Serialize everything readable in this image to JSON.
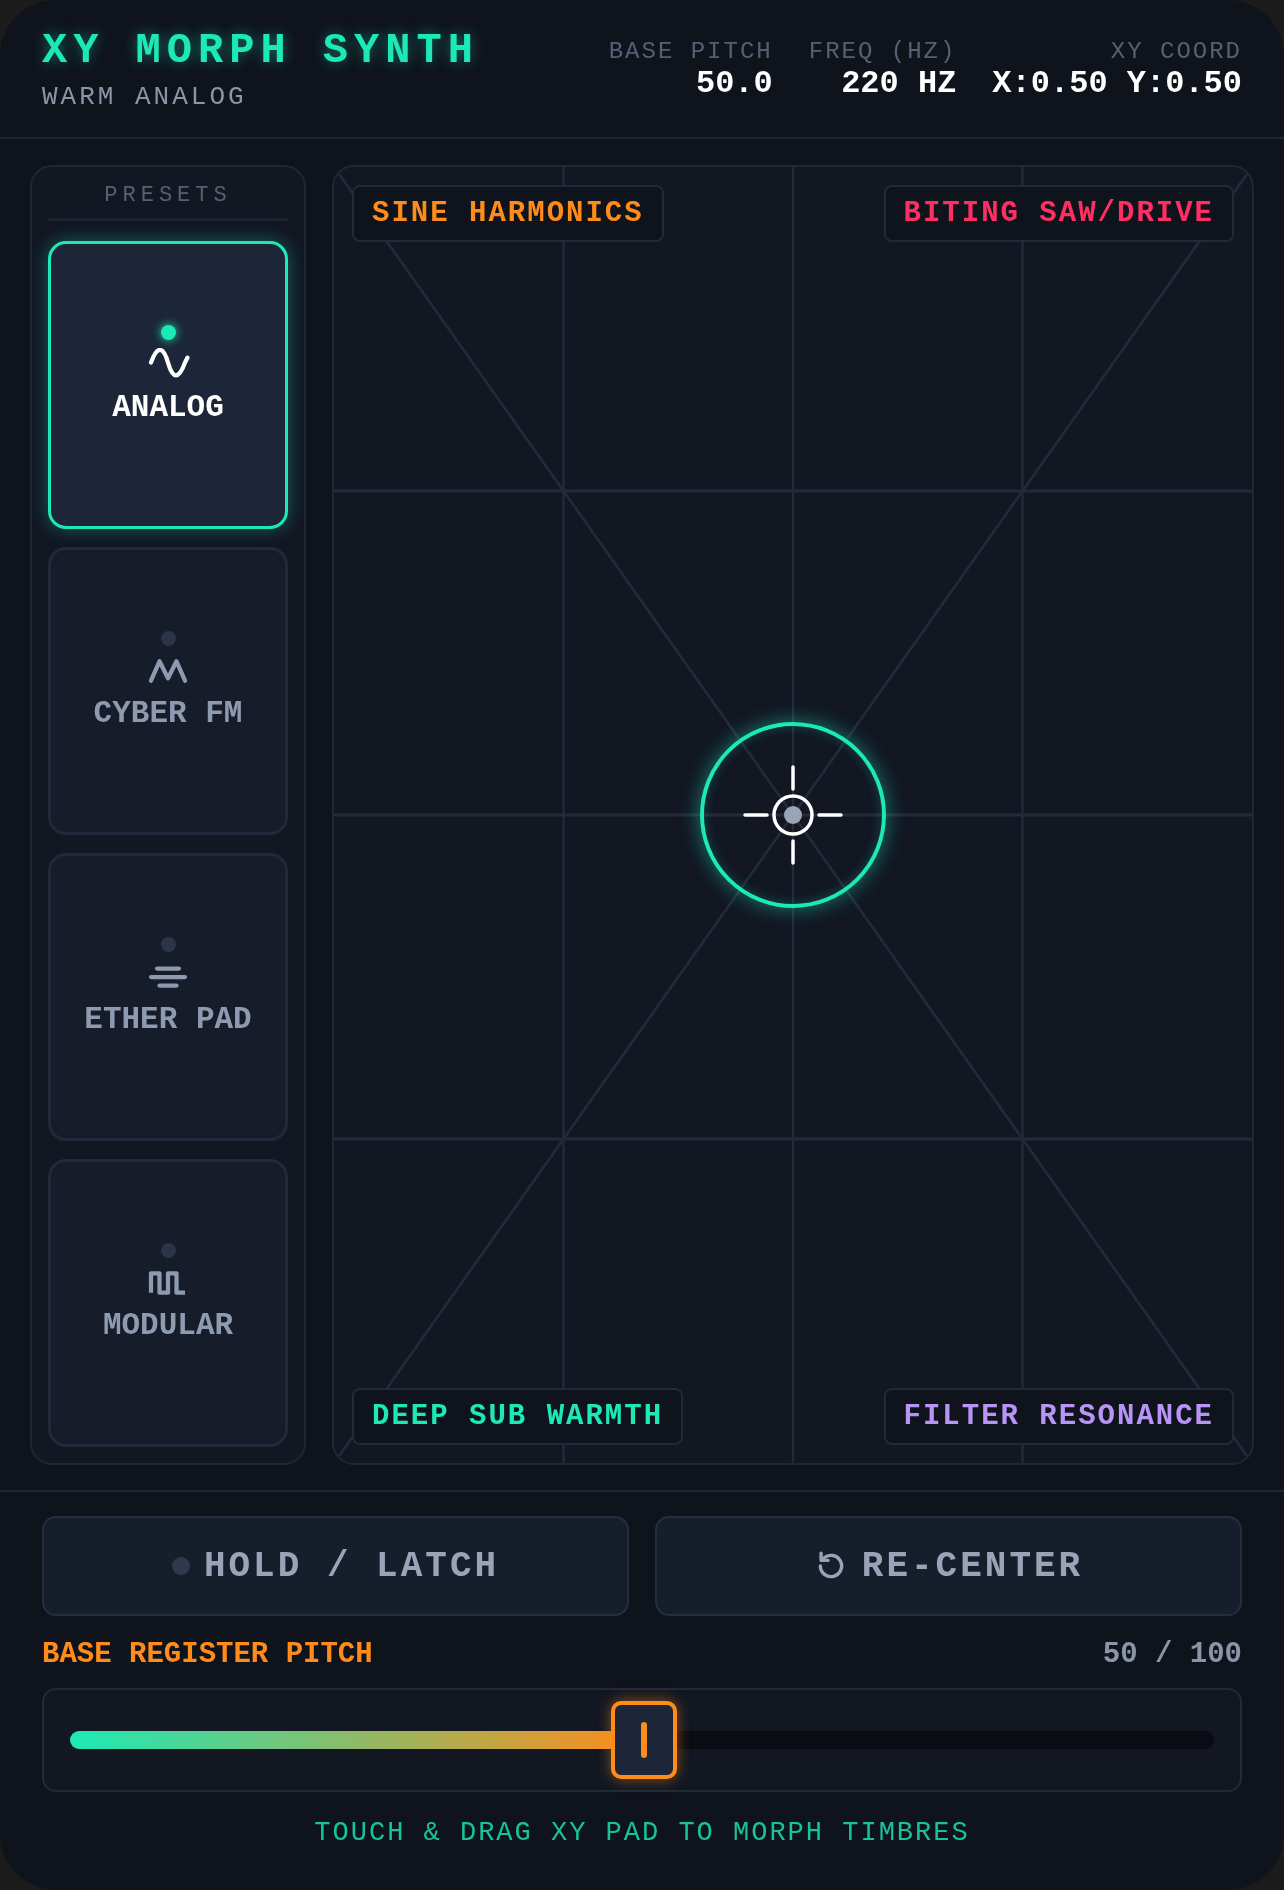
{
  "header": {
    "title": "XY MORPH SYNTH",
    "subtitle": "WARM ANALOG",
    "readouts": [
      {
        "label": "BASE PITCH",
        "value": "50.0"
      },
      {
        "label": "FREQ (HZ)",
        "value": "220 HZ"
      },
      {
        "label": "XY COORD",
        "value": "X:0.50 Y:0.50"
      }
    ]
  },
  "sidebar": {
    "title": "PRESETS",
    "items": [
      {
        "label": "ANALOG",
        "kind": "sine",
        "selected": true
      },
      {
        "label": "CYBER FM",
        "kind": "zigzag",
        "selected": false
      },
      {
        "label": "ETHER PAD",
        "kind": "layers",
        "selected": false
      },
      {
        "label": "MODULAR",
        "kind": "square",
        "selected": false
      }
    ]
  },
  "xy_pad": {
    "corners": [
      {
        "label": "SINE HARMONICS",
        "color": "#ff8c1a"
      },
      {
        "label": "BITING SAW/DRIVE",
        "color": "#ff2e63"
      },
      {
        "label": "DEEP SUB WARMTH",
        "color": "#1de9b6"
      },
      {
        "label": "FILTER RESONANCE",
        "color": "#b794f6"
      }
    ]
  },
  "controls": {
    "hold": {
      "label": "HOLD / LATCH",
      "on": false
    },
    "recenter": {
      "label": "RE-CENTER"
    }
  },
  "pitch": {
    "label": "BASE REGISTER PITCH",
    "reading": "50 / 100",
    "level": 0.5
  },
  "footer": "TOUCH & DRAG XY PAD TO MORPH TIMBRES"
}
